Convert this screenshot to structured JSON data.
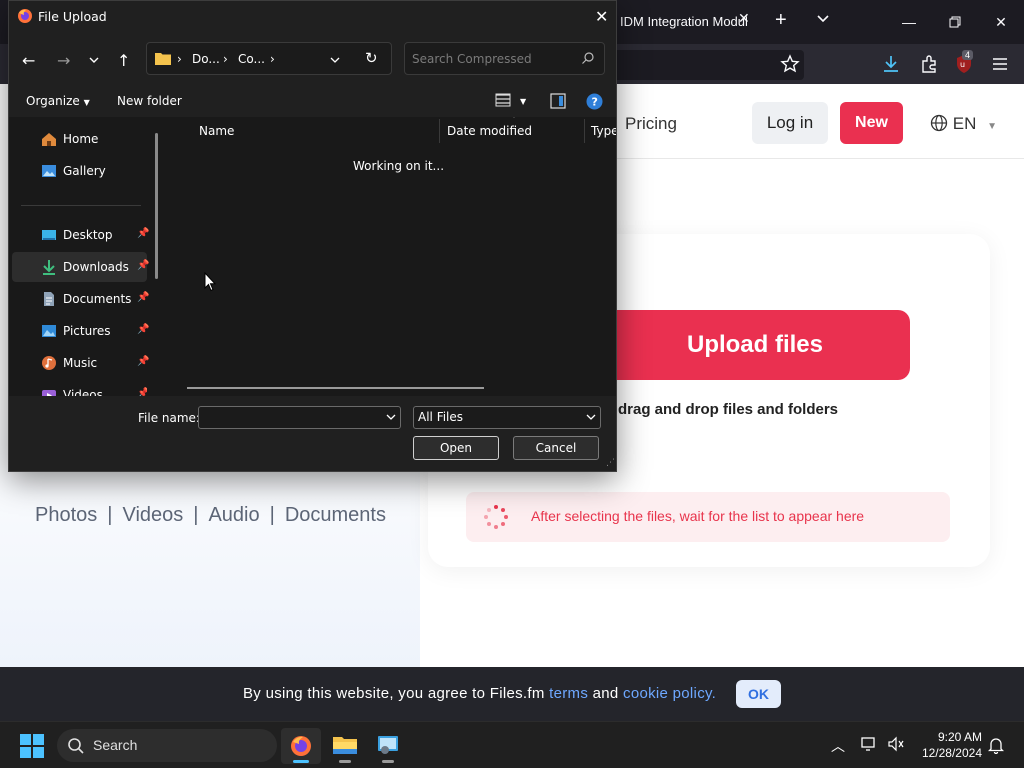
{
  "browser": {
    "tab_title": "IDM Integration Modul",
    "tab_close": "✕",
    "new_tab": "+",
    "extension_badge": "4"
  },
  "site": {
    "nav_pricing": "Pricing",
    "login_label": "Log in",
    "new_label": "New",
    "lang_label": "EN",
    "upload_button": "Upload files",
    "drag_drop_text": "drag and drop files and folders",
    "wait_text": "After selecting the files, wait for the list to appear here",
    "file_types": [
      "Photos",
      "Videos",
      "Audio",
      "Documents"
    ],
    "accent_color": "#ea3050"
  },
  "cookie": {
    "text_before": "By using this website, you agree to Files.fm",
    "terms_link": "terms",
    "and_text": "and",
    "policy_link": "cookie policy.",
    "ok_label": "OK"
  },
  "dialog": {
    "title": "File Upload",
    "breadcrumb": [
      "Do...",
      "Co..."
    ],
    "search_placeholder": "Search Compressed",
    "organize_label": "Organize",
    "new_folder_label": "New folder",
    "sidebar_items": [
      {
        "label": "Home",
        "icon": "home-icon",
        "pinned": false
      },
      {
        "label": "Gallery",
        "icon": "gallery-icon",
        "pinned": false
      },
      {
        "label": "Desktop",
        "icon": "desktop-icon",
        "pinned": true
      },
      {
        "label": "Downloads",
        "icon": "downloads-icon",
        "pinned": true,
        "selected": true
      },
      {
        "label": "Documents",
        "icon": "documents-icon",
        "pinned": true
      },
      {
        "label": "Pictures",
        "icon": "pictures-icon",
        "pinned": true
      },
      {
        "label": "Music",
        "icon": "music-icon",
        "pinned": true
      },
      {
        "label": "Videos",
        "icon": "videos-icon",
        "pinned": true
      }
    ],
    "columns": [
      "Name",
      "Date modified",
      "Type"
    ],
    "status_text": "Working on it...",
    "file_name_label": "File name:",
    "file_name_value": "",
    "filter_value": "All Files",
    "open_label": "Open",
    "cancel_label": "Cancel"
  },
  "taskbar": {
    "search_label": "Search",
    "time": "9:20 AM",
    "date": "12/28/2024"
  }
}
